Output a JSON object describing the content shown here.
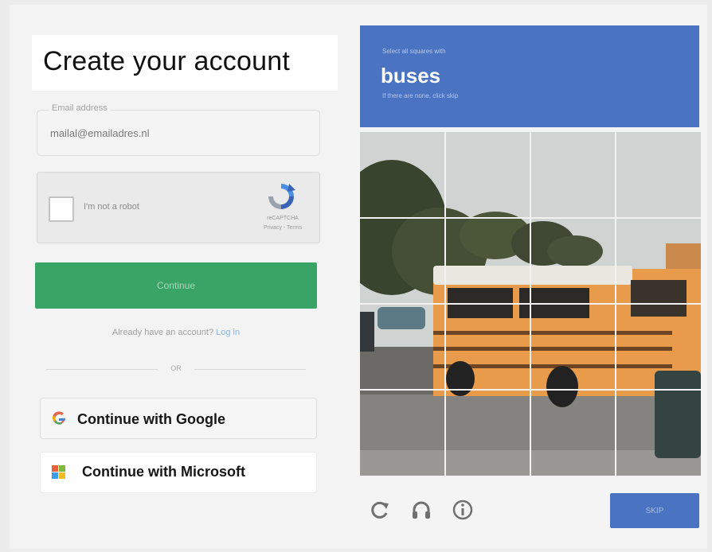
{
  "signup": {
    "title": "Create your account",
    "email_label": "Email address",
    "email_value": "mailal@emailadres.nl",
    "recaptcha": {
      "checkbox_label": "I'm not a robot",
      "brand": "reCAPTCHA",
      "links": "Privacy - Terms"
    },
    "continue_label": "Continue",
    "already_text": "Already have an account?",
    "login_link": "Log in",
    "or_text": "OR",
    "google_label": "Continue with Google",
    "microsoft_label": "Continue with Microsoft"
  },
  "captcha": {
    "instruction": "Select all squares with",
    "target": "buses",
    "subtext": "If there are none, click skip",
    "skip_label": "SKIP",
    "grid_rows": 4,
    "grid_cols": 4,
    "footer_icons": [
      "reload-icon",
      "audio-icon",
      "info-icon"
    ],
    "header_color": "#4a74c2"
  },
  "colors": {
    "continue_green": "#3aa466",
    "captcha_blue": "#4a74c2"
  }
}
